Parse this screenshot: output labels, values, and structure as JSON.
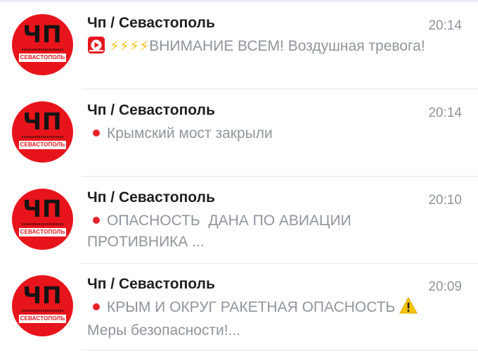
{
  "chats": [
    {
      "title": "Чп / Севастополь",
      "time": "20:14",
      "preview": "ВНИМАНИЕ ВСЕМ! Воздушная тревога!",
      "avatar_text": "ЧП",
      "avatar_city": "СЕВАСТОПОЛЬ",
      "prefix_icons": [
        "play-badge-icon",
        "lightning-icon",
        "lightning-icon",
        "lightning-icon",
        "lightning-icon"
      ]
    },
    {
      "title": "Чп / Севастополь",
      "time": "20:14",
      "preview": "Крымский мост закрыли",
      "avatar_text": "ЧП",
      "avatar_city": "СЕВАСТОПОЛЬ",
      "prefix_icons": [
        "red-circle-icon"
      ]
    },
    {
      "title": "Чп / Севастополь",
      "time": "20:10",
      "preview": "ОПАСНОСТЬ  ДАНА ПО АВИАЦИИ ПРОТИВНИКА ...",
      "avatar_text": "ЧП",
      "avatar_city": "СЕВАСТОПОЛЬ",
      "prefix_icons": [
        "red-circle-icon"
      ]
    },
    {
      "title": "Чп / Севастополь",
      "time": "20:09",
      "preview": "КРЫМ И ОКРУГ РАКЕТНАЯ ОПАСНОСТЬ",
      "preview_line2": "Меры безопасности!...",
      "avatar_text": "ЧП",
      "avatar_city": "СЕВАСТОПОЛЬ",
      "prefix_icons": [
        "red-circle-icon"
      ],
      "suffix_icons": [
        "warning-icon"
      ]
    }
  ],
  "colors": {
    "avatar_red": "#e8141b",
    "title_text": "#1f1f1f",
    "secondary_text": "#8e959d",
    "lightning": "#f3c21a",
    "red_dot": "#e9232b"
  }
}
